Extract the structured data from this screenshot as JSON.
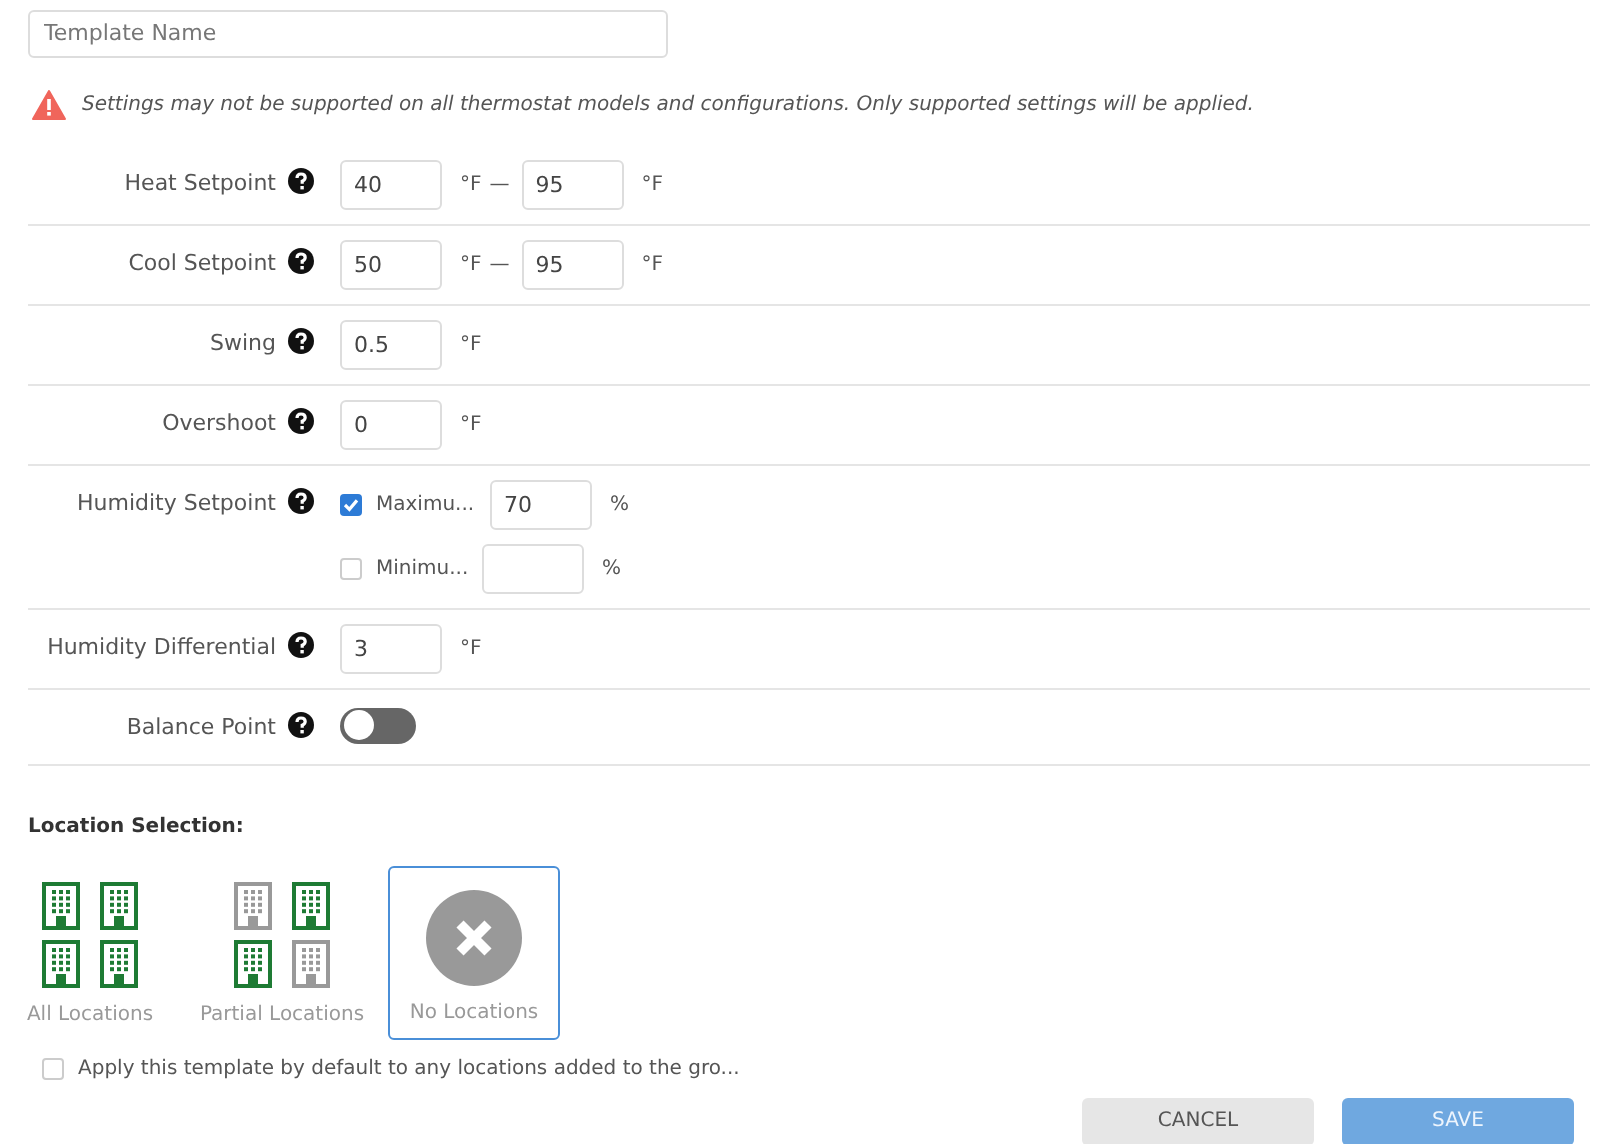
{
  "template_name": {
    "placeholder": "Template Name"
  },
  "warning": "Settings may not be supported on all thermostat models and configurations. Only supported settings will be applied.",
  "settings": [
    {
      "kind": "range",
      "label": "Heat Setpoint",
      "from": "40",
      "from_unit": "°F",
      "dash": "—",
      "to": "95",
      "to_unit": "°F"
    },
    {
      "kind": "range",
      "label": "Cool Setpoint",
      "from": "50",
      "from_unit": "°F",
      "dash": "—",
      "to": "95",
      "to_unit": "°F"
    },
    {
      "kind": "single",
      "label": "Swing",
      "value": "0.5",
      "unit": "°F"
    },
    {
      "kind": "single",
      "label": "Overshoot",
      "value": "0",
      "unit": "°F"
    },
    {
      "kind": "humidity",
      "label": "Humidity Setpoint",
      "options": [
        {
          "label": "Maximu...",
          "checked": true,
          "value": "70",
          "unit": "%"
        },
        {
          "label": "Minimu...",
          "checked": false,
          "unit": "%"
        }
      ]
    },
    {
      "kind": "single",
      "label": "Humidity Differential",
      "value": "3",
      "unit": "°F"
    },
    {
      "kind": "toggle",
      "label": "Balance Point",
      "on": false
    }
  ],
  "location_selection": {
    "title": "Location Selection:",
    "options": [
      {
        "kind": "buildings",
        "label": "All Locations",
        "buildings": [
          true,
          true,
          true,
          true
        ],
        "selected": false
      },
      {
        "kind": "buildings",
        "label": "Partial Locations",
        "buildings": [
          false,
          true,
          true,
          false
        ],
        "selected": false
      },
      {
        "kind": "none",
        "label": "No Locations",
        "selected": true
      }
    ]
  },
  "apply_default": {
    "label": "Apply this template by default to any locations added to the gro...",
    "checked": false
  },
  "buttons": [
    {
      "label": "CANCEL",
      "kind": "secondary",
      "disabled": false
    },
    {
      "label": "SAVE",
      "kind": "primary",
      "disabled": true
    }
  ]
}
